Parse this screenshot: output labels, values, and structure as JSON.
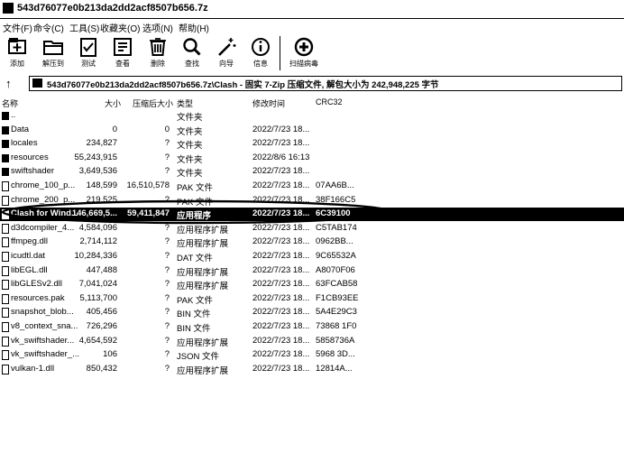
{
  "window": {
    "title": "543d76077e0b213da2dd2acf8507b656.7z"
  },
  "menu": [
    "文件(F)",
    "命令(C)",
    "工具(S)",
    "收藏夹(O)",
    "选项(N)",
    "帮助(H)"
  ],
  "toolbar": [
    {
      "label": "添加",
      "icon": "add-icon"
    },
    {
      "label": "解压到",
      "icon": "extract-folder-icon"
    },
    {
      "label": "测试",
      "icon": "test-clipboard-icon"
    },
    {
      "label": "查看",
      "icon": "view-book-icon"
    },
    {
      "label": "删除",
      "icon": "delete-bin-icon"
    },
    {
      "label": "查找",
      "icon": "find-magnifier-icon"
    },
    {
      "label": "向导",
      "icon": "wizard-wand-icon"
    },
    {
      "label": "信息",
      "icon": "info-icon"
    },
    {
      "label": "扫描病毒",
      "icon": "scan-virus-icon"
    }
  ],
  "address": {
    "path": "543d76077e0b213da2dd2acf8507b656.7z\\Clash - 固实 7-Zip 压缩文件, 解包大小为 242,948,225 字节"
  },
  "columns": {
    "name": "名称",
    "size": "大小",
    "packed": "压缩后大小",
    "type": "类型",
    "modified": "修改时间",
    "crc": "CRC32"
  },
  "files": [
    {
      "name": "..",
      "size": "",
      "packed": "",
      "type": "文件夹",
      "modified": "",
      "crc": "",
      "folder": true
    },
    {
      "name": "Data",
      "size": "0",
      "packed": "0",
      "type": "文件夹",
      "modified": "2022/7/23 18...",
      "crc": "",
      "folder": true
    },
    {
      "name": "locales",
      "size": "234,827",
      "packed": "?",
      "type": "文件夹",
      "modified": "2022/7/23 18...",
      "crc": "",
      "folder": true
    },
    {
      "name": "resources",
      "size": "55,243,915",
      "packed": "?",
      "type": "文件夹",
      "modified": "2022/8/6 16:13",
      "crc": "",
      "folder": true
    },
    {
      "name": "swiftshader",
      "size": "3,649,536",
      "packed": "?",
      "type": "文件夹",
      "modified": "2022/7/23 18...",
      "crc": "",
      "folder": true
    },
    {
      "name": "chrome_100_p...",
      "size": "148,599",
      "packed": "16,510,578",
      "type": "PAK 文件",
      "modified": "2022/7/23 18...",
      "crc": "07AA6B...",
      "folder": false
    },
    {
      "name": "chrome_200_p...",
      "size": "219,525",
      "packed": "?",
      "type": "PAK 文件",
      "modified": "2022/7/23 18...",
      "crc": "38F166C5",
      "folder": false
    },
    {
      "name": "Clash for Wind...",
      "size": "146,669,5...",
      "packed": "59,411,847",
      "type": "应用程序",
      "modified": "2022/7/23 18...",
      "crc": "6C39100",
      "folder": false,
      "selected": true
    },
    {
      "name": "d3dcompiler_4...",
      "size": "4,584,096",
      "packed": "?",
      "type": "应用程序扩展",
      "modified": "2022/7/23 18...",
      "crc": "C5TAB174",
      "folder": false
    },
    {
      "name": "ffmpeg.dll",
      "size": "2,714,112",
      "packed": "?",
      "type": "应用程序扩展",
      "modified": "2022/7/23 18...",
      "crc": "0962BB...",
      "folder": false
    },
    {
      "name": "icudtl.dat",
      "size": "10,284,336",
      "packed": "?",
      "type": "DAT 文件",
      "modified": "2022/7/23 18...",
      "crc": "9C65532A",
      "folder": false
    },
    {
      "name": "libEGL.dll",
      "size": "447,488",
      "packed": "?",
      "type": "应用程序扩展",
      "modified": "2022/7/23 18...",
      "crc": "A8070F06",
      "folder": false
    },
    {
      "name": "libGLESv2.dll",
      "size": "7,041,024",
      "packed": "?",
      "type": "应用程序扩展",
      "modified": "2022/7/23 18...",
      "crc": "63FCAB58",
      "folder": false
    },
    {
      "name": "resources.pak",
      "size": "5,113,700",
      "packed": "?",
      "type": "PAK 文件",
      "modified": "2022/7/23 18...",
      "crc": "F1CB93EE",
      "folder": false
    },
    {
      "name": "snapshot_blob...",
      "size": "405,456",
      "packed": "?",
      "type": "BIN 文件",
      "modified": "2022/7/23 18...",
      "crc": "5A4E29C3",
      "folder": false
    },
    {
      "name": "v8_context_sna...",
      "size": "726,296",
      "packed": "?",
      "type": "BIN 文件",
      "modified": "2022/7/23 18...",
      "crc": "73868 1F0",
      "folder": false
    },
    {
      "name": "vk_swiftshader...",
      "size": "4,654,592",
      "packed": "?",
      "type": "应用程序扩展",
      "modified": "2022/7/23 18...",
      "crc": "5858736A",
      "folder": false
    },
    {
      "name": "vk_swiftshader_...",
      "size": "106",
      "packed": "?",
      "type": "JSON 文件",
      "modified": "2022/7/23 18...",
      "crc": "5968 3D...",
      "folder": false
    },
    {
      "name": "vulkan-1.dll",
      "size": "850,432",
      "packed": "?",
      "type": "应用程序扩展",
      "modified": "2022/7/23 18...",
      "crc": "12814A...",
      "folder": false
    }
  ]
}
